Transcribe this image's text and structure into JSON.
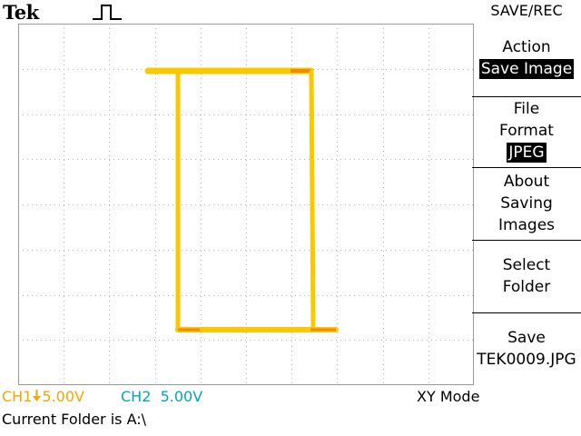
{
  "header": {
    "brand": "Tek",
    "trigger_icon": "pulse-trigger-icon",
    "menu_title": "SAVE/REC"
  },
  "menu": {
    "items": [
      {
        "lines": [
          "Action"
        ],
        "value": "Save Image"
      },
      {
        "lines": [
          "File",
          "Format"
        ],
        "value": "JPEG"
      },
      {
        "lines": [
          "About",
          "Saving",
          "Images"
        ],
        "value": ""
      },
      {
        "lines": [
          "Select",
          "Folder"
        ],
        "value": ""
      },
      {
        "lines": [
          "Save"
        ],
        "value": "TEK0009.JPG"
      }
    ]
  },
  "status": {
    "ch1_label": "CH1",
    "ch1_coupling_icon": "dc-ground-icon",
    "ch1_scale": "5.00V",
    "ch2_label": "CH2",
    "ch2_scale": "5.00V",
    "mode": "XY Mode",
    "folder": "Current Folder is A:\\"
  },
  "colors": {
    "ch1": "#f5a600",
    "ch2": "#00a9b5",
    "trace": "#f9c800",
    "trace_corner": "#f28a00",
    "grid": "#b4b4b4"
  }
}
